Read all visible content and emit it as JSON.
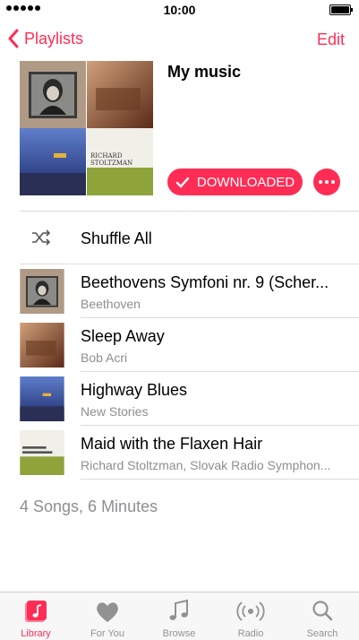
{
  "status_bar": {
    "time": "10:00"
  },
  "nav": {
    "back_label": "Playlists",
    "edit_label": "Edit"
  },
  "playlist": {
    "title": "My music",
    "download_label": "DOWNLOADED"
  },
  "shuffle_label": "Shuffle All",
  "songs": [
    {
      "title": "Beethovens Symfoni nr. 9 (Scher...",
      "artist": "Beethoven"
    },
    {
      "title": "Sleep Away",
      "artist": "Bob Acri"
    },
    {
      "title": "Highway Blues",
      "artist": "New Stories"
    },
    {
      "title": "Maid with the Flaxen Hair",
      "artist": "Richard Stoltzman, Slovak Radio Symphon..."
    }
  ],
  "summary": "4 Songs, 6 Minutes",
  "tabs": [
    {
      "label": "Library",
      "icon": "music-note-square-icon",
      "active": true
    },
    {
      "label": "For You",
      "icon": "heart-icon",
      "active": false
    },
    {
      "label": "Browse",
      "icon": "music-notes-icon",
      "active": false
    },
    {
      "label": "Radio",
      "icon": "radio-waves-icon",
      "active": false
    },
    {
      "label": "Search",
      "icon": "search-icon",
      "active": false
    }
  ],
  "colors": {
    "accent": "#ff2d55",
    "secondary_text": "#8e8e93"
  },
  "album_art": {
    "text": [
      "RICHARD",
      "STOLTZMAN"
    ]
  }
}
